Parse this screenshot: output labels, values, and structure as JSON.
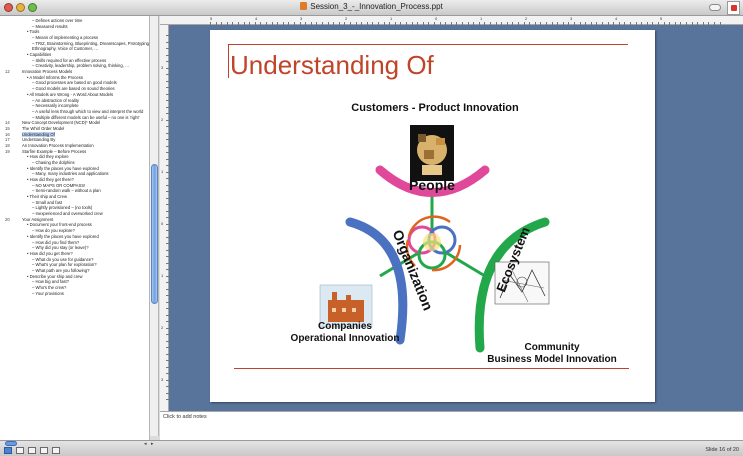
{
  "window": {
    "title": "Session_3_-_Innovation_Process.ppt",
    "colors": {
      "close": "#e05a4e",
      "minimize": "#e9b23c",
      "zoom": "#6bbf4a",
      "accent": "#c0442a"
    }
  },
  "outline": {
    "lines": [
      {
        "num": "",
        "indent": 2,
        "text": "– Defines actions over time"
      },
      {
        "num": "",
        "indent": 2,
        "text": "– Measured results"
      },
      {
        "num": "",
        "indent": 1,
        "text": "• Tools"
      },
      {
        "num": "",
        "indent": 2,
        "text": "– Means of implementing a process"
      },
      {
        "num": "",
        "indent": 2,
        "text": "– TRIZ, Brainstorming, Blueprinting, Dreamscapes, Prototyping"
      },
      {
        "num": "",
        "indent": 2,
        "text": "Ethnography, Voice of Customer, …"
      },
      {
        "num": "",
        "indent": 1,
        "text": "• Capabilities"
      },
      {
        "num": "",
        "indent": 2,
        "text": "– Skills required for an effective process"
      },
      {
        "num": "",
        "indent": 2,
        "text": "– Creativity, leadership, problem solving, thinking, …"
      },
      {
        "num": "12",
        "indent": 0,
        "text": "Innovation Process Models"
      },
      {
        "num": "",
        "indent": 1,
        "text": "• A Model Informs the Process"
      },
      {
        "num": "",
        "indent": 2,
        "text": "– Good processes are based on good models"
      },
      {
        "num": "",
        "indent": 2,
        "text": "– Good models are based on sound theories"
      },
      {
        "num": "",
        "indent": 1,
        "text": "• All Models are Wrong - A Word About Models"
      },
      {
        "num": "",
        "indent": 2,
        "text": "– An abstraction of reality"
      },
      {
        "num": "",
        "indent": 2,
        "text": "– Necessarily incomplete"
      },
      {
        "num": "",
        "indent": 2,
        "text": "– A useful lens through which to view and interpret the world"
      },
      {
        "num": "",
        "indent": 2,
        "text": "– Multiple different models can be useful – no one is 'right'"
      },
      {
        "num": "14",
        "indent": 0,
        "text": "New Concept Development (NCD)* Model"
      },
      {
        "num": "15",
        "indent": 0,
        "text": "The Whirl Order Model"
      },
      {
        "num": "16",
        "indent": 0,
        "text": "Understanding Of",
        "selected": true
      },
      {
        "num": "17",
        "indent": 0,
        "text": "Understanding By"
      },
      {
        "num": "18",
        "indent": 0,
        "text": "An Innovation Process Implementation"
      },
      {
        "num": "19",
        "indent": 0,
        "text": "Starfire Example – Before Process"
      },
      {
        "num": "",
        "indent": 1,
        "text": "• How did they explore"
      },
      {
        "num": "",
        "indent": 2,
        "text": "– Chasing the dolphins"
      },
      {
        "num": "",
        "indent": 1,
        "text": "• Identify the places you have explored"
      },
      {
        "num": "",
        "indent": 2,
        "text": "– Many, many industries and applications"
      },
      {
        "num": "",
        "indent": 1,
        "text": "• How did they get there?"
      },
      {
        "num": "",
        "indent": 2,
        "text": "– NO MAPS OR COMPASS!"
      },
      {
        "num": "",
        "indent": 2,
        "text": "– Semi-random walk – without a plan"
      },
      {
        "num": "",
        "indent": 1,
        "text": "• Their ship and Crew"
      },
      {
        "num": "",
        "indent": 2,
        "text": "– Small and fast"
      },
      {
        "num": "",
        "indent": 2,
        "text": "– Lightly provisioned – (no tools)"
      },
      {
        "num": "",
        "indent": 2,
        "text": "– Inexperienced and overworked crew"
      },
      {
        "num": "20",
        "indent": 0,
        "text": "Your Assignment"
      },
      {
        "num": "",
        "indent": 1,
        "text": "• Document your front-end process"
      },
      {
        "num": "",
        "indent": 2,
        "text": "– How do you explore?"
      },
      {
        "num": "",
        "indent": 1,
        "text": "• Identify the places you have explored"
      },
      {
        "num": "",
        "indent": 2,
        "text": "– How did you find them?"
      },
      {
        "num": "",
        "indent": 2,
        "text": "– Why did you stay (or leave)?"
      },
      {
        "num": "",
        "indent": 1,
        "text": "• How did you get there?"
      },
      {
        "num": "",
        "indent": 2,
        "text": "– What do you use for guidance?"
      },
      {
        "num": "",
        "indent": 2,
        "text": "– What's your plan for exploration?"
      },
      {
        "num": "",
        "indent": 2,
        "text": "– What path are you following?"
      },
      {
        "num": "",
        "indent": 1,
        "text": "• Describe your ship and crew"
      },
      {
        "num": "",
        "indent": 2,
        "text": "– How big and fast?"
      },
      {
        "num": "",
        "indent": 2,
        "text": "– Who's the crew?"
      },
      {
        "num": "",
        "indent": 2,
        "text": "– Your provisions"
      }
    ]
  },
  "ruler": {
    "h_numbers": [
      "5",
      "4",
      "3",
      "2",
      "1",
      "0",
      "1",
      "2",
      "3",
      "4",
      "5"
    ],
    "v_numbers": [
      "3",
      "2",
      "1",
      "0",
      "1",
      "2",
      "3"
    ]
  },
  "slide": {
    "title": "Understanding Of",
    "heading_top": "Customers - Product Innovation",
    "arc_people": "People",
    "arc_organization": "Organization",
    "arc_ecosystem": "Ecosystem",
    "label_left_1": "Companies",
    "label_left_2": "Operational Innovation",
    "label_right_1": "Community",
    "label_right_2": "Business Model Innovation",
    "colors": {
      "people": "#e0489a",
      "organization": "#4a72c0",
      "ecosystem": "#22a84a",
      "arrows": "#e0641e"
    }
  },
  "notes": {
    "placeholder": "Click to add notes"
  },
  "status": {
    "slide_count": "Slide 16 of 20"
  }
}
